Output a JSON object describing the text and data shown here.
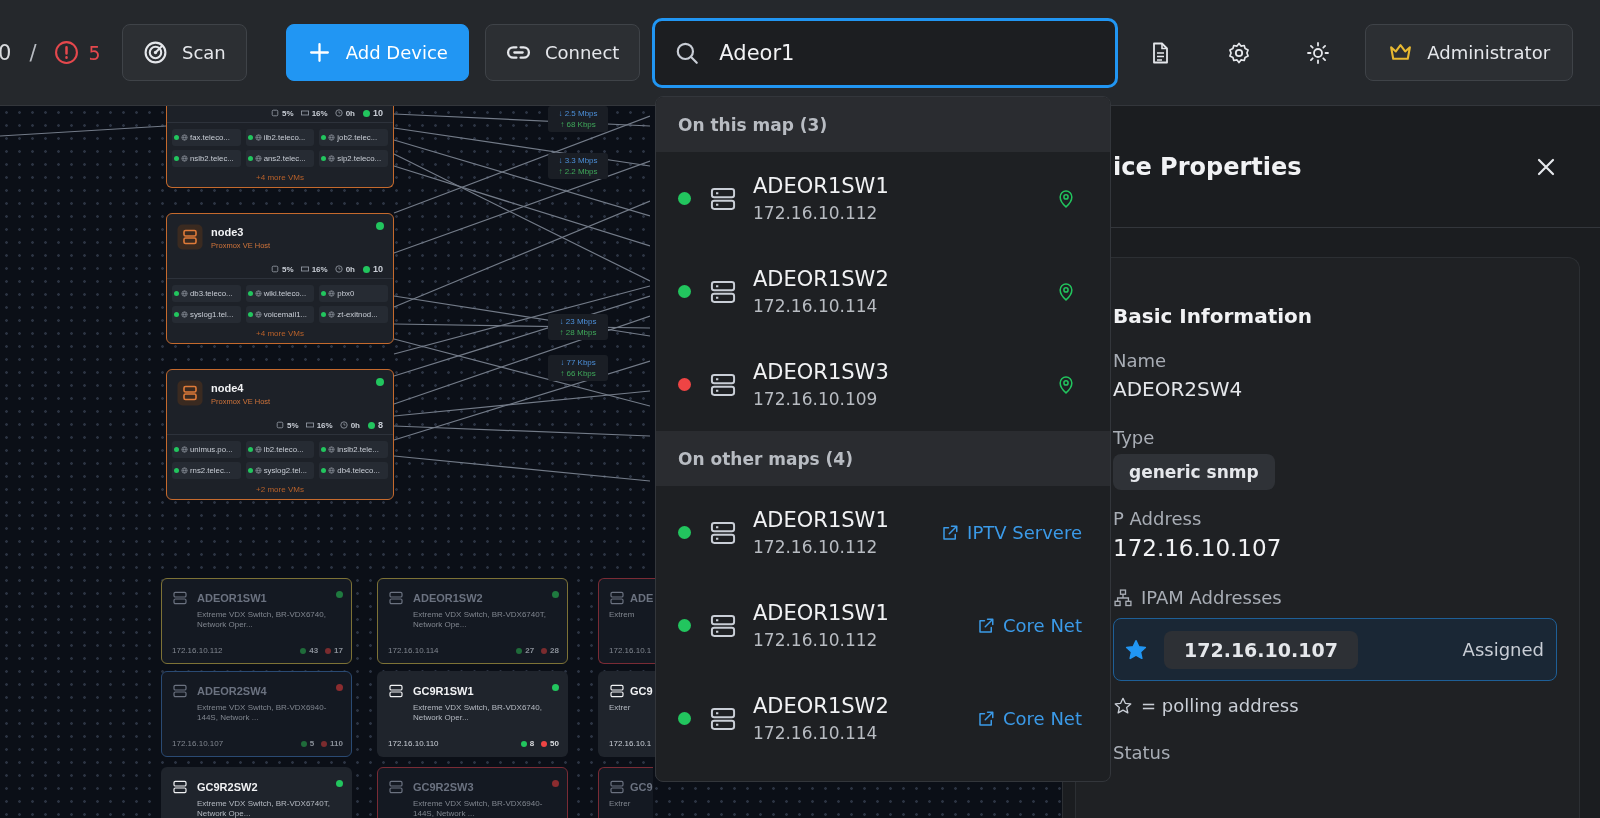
{
  "toolbar": {
    "counter": {
      "online": "0",
      "separator": "/",
      "alerts": "5"
    },
    "buttons": [
      {
        "label": "Scan",
        "kind": "scan"
      },
      {
        "label": "Add Device",
        "kind": "add"
      },
      {
        "label": "Connect",
        "kind": "connect"
      }
    ],
    "search": {
      "value": "Adeor1",
      "focused": true
    },
    "user": {
      "label": "Administrator"
    }
  },
  "map": {
    "hosts": [
      {
        "stats": {
          "cpu": "5%",
          "memory": "16%",
          "uptime": "0h",
          "vms": "10"
        },
        "vms": [
          {
            "name": "fax.teleco...",
            "online": true
          },
          {
            "name": "ilb2.teleco...",
            "online": true
          },
          {
            "name": "job2.telec...",
            "online": true
          },
          {
            "name": "nslb2.telec...",
            "online": true
          },
          {
            "name": "ans2.telec...",
            "online": true
          },
          {
            "name": "sip2.teleco...",
            "online": true
          }
        ],
        "more": "+4 more VMs"
      },
      {
        "name": "node3",
        "subtitle": "Proxmox VE Host",
        "online": true,
        "stats": {
          "cpu": "5%",
          "memory": "16%",
          "uptime": "0h",
          "vms": "10"
        },
        "vms": [
          {
            "name": "db3.teleco...",
            "online": true
          },
          {
            "name": "wiki.teleco...",
            "online": true
          },
          {
            "name": "pbx0",
            "online": true
          },
          {
            "name": "syslog1.tel...",
            "online": true
          },
          {
            "name": "voicemail1...",
            "online": true
          },
          {
            "name": "zt-exitnod...",
            "online": true
          }
        ],
        "more": "+4 more VMs"
      },
      {
        "name": "node4",
        "subtitle": "Proxmox VE Host",
        "online": true,
        "stats": {
          "cpu": "5%",
          "memory": "16%",
          "uptime": "0h",
          "vms": "8"
        },
        "vms": [
          {
            "name": "unimus.po...",
            "online": true
          },
          {
            "name": "lb2.teleco...",
            "online": true
          },
          {
            "name": "inslb2.tele...",
            "online": true
          },
          {
            "name": "rns2.telec...",
            "online": true
          },
          {
            "name": "syslog2.tel...",
            "online": true
          },
          {
            "name": "db4.teleco...",
            "online": true
          }
        ],
        "more": "+2 more VMs"
      }
    ],
    "traffic": [
      {
        "down": "↓ 2.5 Mbps",
        "up": "↑ 68 Kbps"
      },
      {
        "down": "↓ 3.3 Mbps",
        "up": "↑ 2.2 Mbps"
      },
      {
        "down": "↓ 23 Mbps",
        "up": "↑ 28 Mbps"
      },
      {
        "down": "↓ 77 Kbps",
        "up": "↑ 66 Kbps"
      }
    ],
    "switches": [
      {
        "name": "ADEOR1SW1",
        "description": "Extreme VDX Switch, BR-VDX6740, Network Oper...",
        "ip": "172.16.10.112",
        "ports_up": "43",
        "ports_down": "17",
        "online": true,
        "color": "#7d7236",
        "selected": false,
        "dimmed": true
      },
      {
        "name": "ADEOR1SW2",
        "description": "Extreme VDX Switch, BR-VDX6740T, Network Ope...",
        "ip": "172.16.10.114",
        "ports_up": "27",
        "ports_down": "28",
        "online": true,
        "color": "#7d7236",
        "selected": false,
        "dimmed": true
      },
      {
        "name": "ADE",
        "description": "Extrem",
        "ip": "172.16.10.1",
        "color": "#7a2b35",
        "selected": false,
        "dimmed": true,
        "clipped": true
      },
      {
        "name": "ADEOR2SW4",
        "description": "Extreme VDX Switch, BR-VDX6940-144S, Network ...",
        "ip": "172.16.10.107",
        "ports_up": "5",
        "ports_down": "110",
        "online": false,
        "selected": true,
        "dimmed": true
      },
      {
        "name": "GC9R1SW1",
        "description": "Extreme VDX Switch, BR-VDX6740, Network Oper...",
        "ip": "172.16.10.110",
        "ports_up": "8",
        "ports_down": "50",
        "online": true,
        "selected": false,
        "dimmed": false
      },
      {
        "name": "GC9",
        "description": "Extrer",
        "ip": "172.16.10.1",
        "selected": false,
        "dimmed": false,
        "clipped": true
      },
      {
        "name": "GC9R2SW2",
        "description": "Extreme VDX Switch, BR-VDX6740T, Network Ope...",
        "online": true,
        "selected": false,
        "dimmed": false
      },
      {
        "name": "GC9R2SW3",
        "description": "Extreme VDX Switch, BR-VDX6940-144S, Network ...",
        "online": false,
        "color": "#7a2b35",
        "selected": false,
        "dimmed": true
      },
      {
        "name": "GC9",
        "description": "Extrer",
        "color": "#7a2b35",
        "selected": false,
        "dimmed": true,
        "clipped": true
      }
    ]
  },
  "search_results": [
    {
      "title": "On this map (3)",
      "kind": "local",
      "items": [
        {
          "name": "ADEOR1SW1",
          "ip": "172.16.10.112",
          "online": true
        },
        {
          "name": "ADEOR1SW2",
          "ip": "172.16.10.114",
          "online": true
        },
        {
          "name": "ADEOR1SW3",
          "ip": "172.16.10.109",
          "online": false
        }
      ]
    },
    {
      "title": "On other maps (4)",
      "kind": "remote",
      "items": [
        {
          "name": "ADEOR1SW1",
          "ip": "172.16.10.112",
          "online": true,
          "map": "IPTV Servere"
        },
        {
          "name": "ADEOR1SW1",
          "ip": "172.16.10.112",
          "online": true,
          "map": "Core Net"
        },
        {
          "name": "ADEOR1SW2",
          "ip": "172.16.10.114",
          "online": true,
          "map": "Core Net"
        }
      ]
    }
  ],
  "panel": {
    "title": "ice Properties",
    "section": "Basic Information",
    "fields": [
      {
        "label": "Name",
        "value": "ADEOR2SW4",
        "kind": "text"
      },
      {
        "label": "Type",
        "value": "generic snmp",
        "kind": "chip"
      },
      {
        "label": "P Address",
        "value": "172.16.10.107",
        "kind": "large"
      }
    ],
    "ipam": {
      "label": "IPAM Addresses",
      "addresses": [
        {
          "address": "172.16.10.107",
          "status": "Assigned",
          "polling": true
        }
      ],
      "legend": "= polling address"
    },
    "next_label": "Status"
  }
}
